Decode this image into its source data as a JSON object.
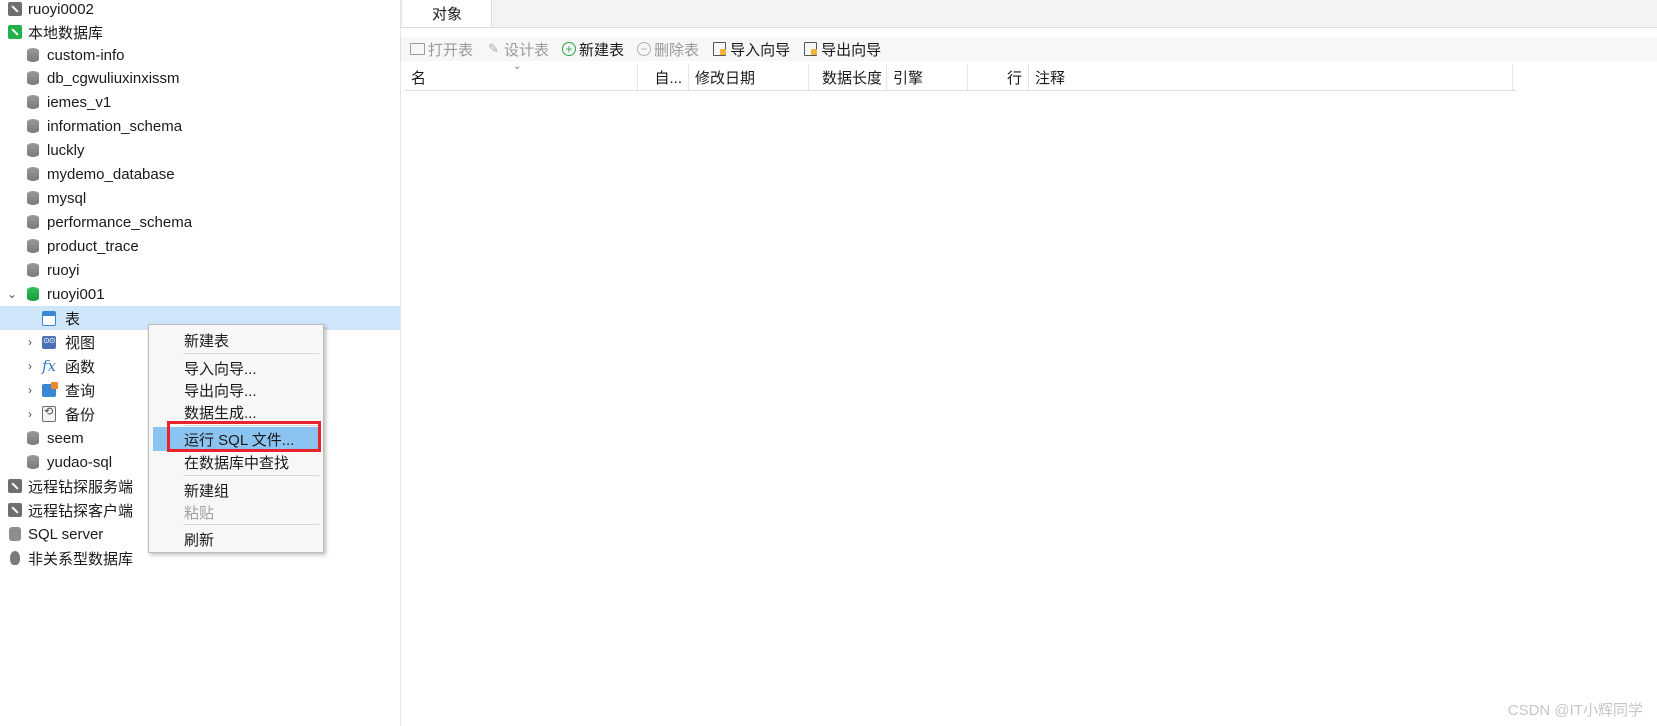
{
  "tree": {
    "conn_ruoyi0002": "ruoyi0002",
    "conn_local": "本地数据库",
    "databases": [
      "custom-info",
      "db_cgwuliuxinxissm",
      "iemes_v1",
      "information_schema",
      "luckly",
      "mydemo_database",
      "mysql",
      "performance_schema",
      "product_trace",
      "ruoyi"
    ],
    "open_db": "ruoyi001",
    "open_db_children": [
      "表",
      "视图",
      "函数",
      "查询",
      "备份"
    ],
    "databases_after": [
      "seem",
      "yudao-sql"
    ],
    "other_connections": [
      "远程钻探服务端",
      "远程钻探客户端",
      "SQL server",
      "非关系型数据库"
    ]
  },
  "tabs": {
    "objects": "对象"
  },
  "toolbar": {
    "open_table": "打开表",
    "design_table": "设计表",
    "new_table": "新建表",
    "delete_table": "删除表",
    "import_wizard": "导入向导",
    "export_wizard": "导出向导"
  },
  "grid": {
    "columns": [
      "名",
      "自...",
      "修改日期",
      "数据长度",
      "引擎",
      "行",
      "注释"
    ]
  },
  "context_menu": {
    "new_table": "新建表",
    "import_wizard": "导入向导...",
    "export_wizard": "导出向导...",
    "data_generation": "数据生成...",
    "run_sql_file": "运行 SQL 文件...",
    "find_in_db": "在数据库中查找",
    "new_group": "新建组",
    "paste": "粘贴",
    "refresh": "刷新"
  },
  "watermark": "CSDN @IT小辉同学",
  "colors": {
    "selection": "#cfe6fb",
    "menu_highlight": "#8cc4f1",
    "annotation_red": "#e8232a",
    "db_green": "#22b14c"
  }
}
